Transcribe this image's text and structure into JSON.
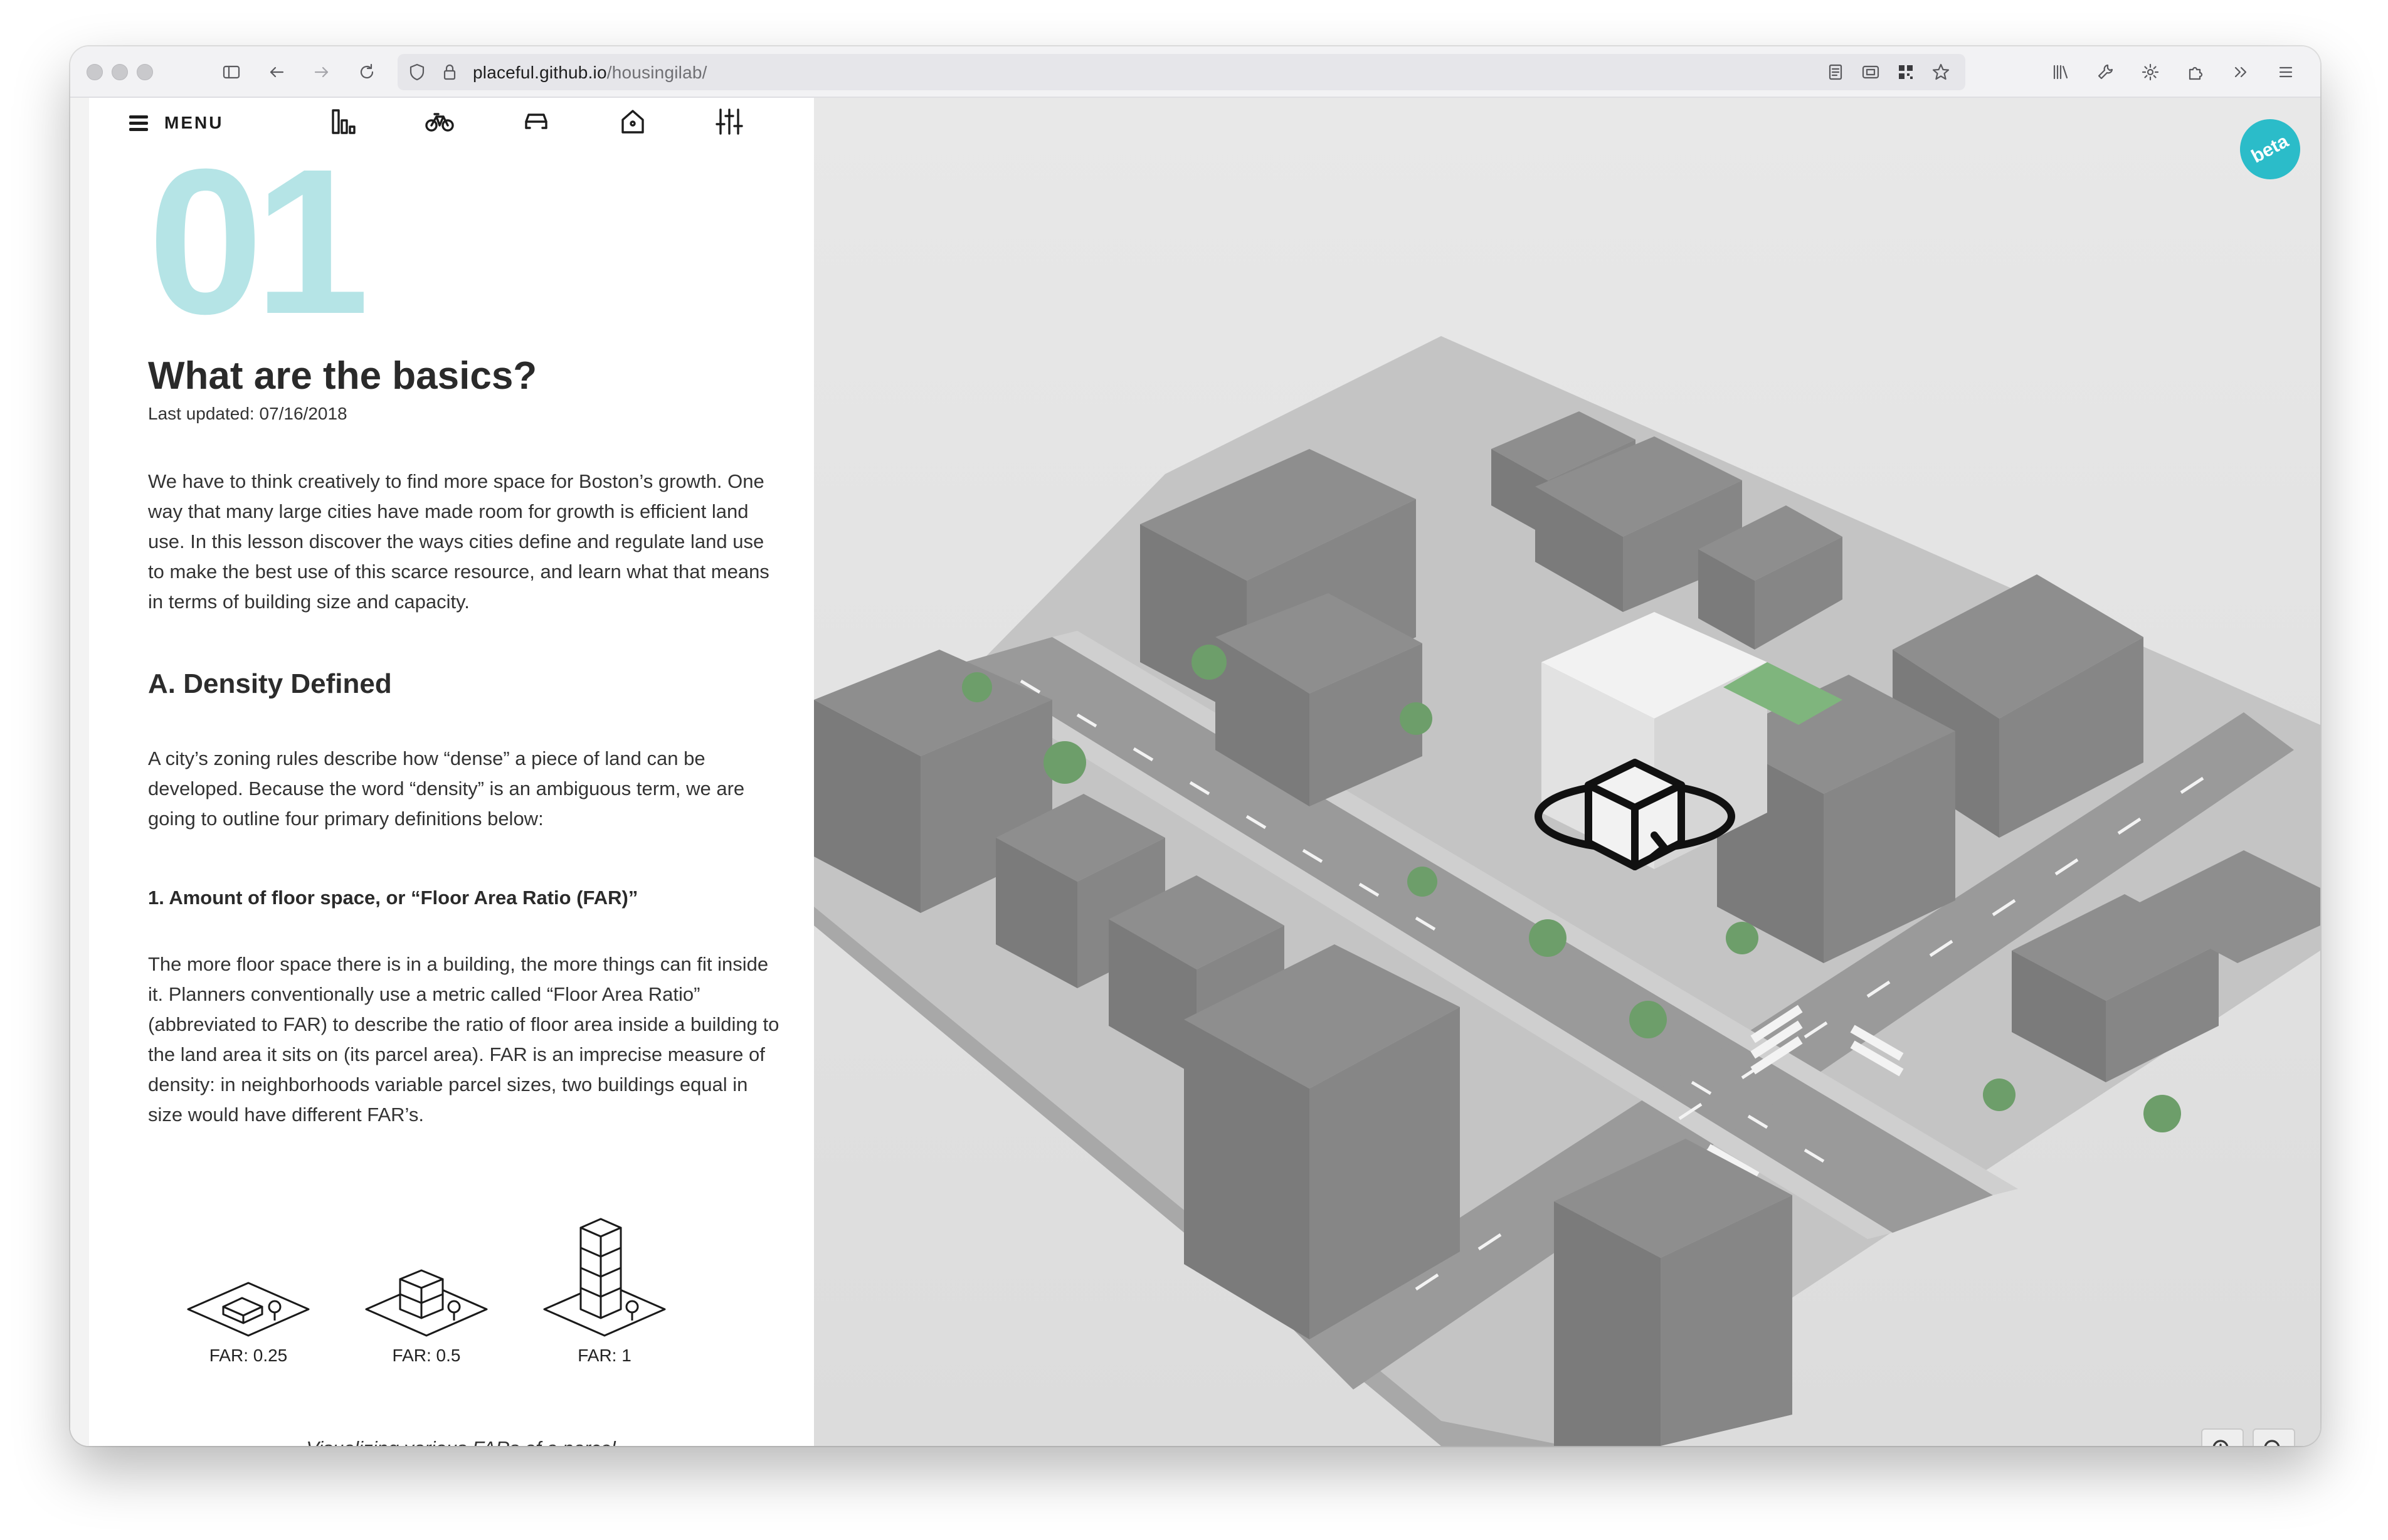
{
  "browser": {
    "url_host": "placeful.github.io",
    "url_path": "/housingilab/"
  },
  "nav": {
    "menu_label": "MENU"
  },
  "lesson": {
    "number": "01",
    "title": "What are the basics?",
    "updated": "Last updated: 07/16/2018",
    "intro": "We have to think creatively to find more space for Boston’s growth. One way that many large cities have made room for growth is efficient land use. In this lesson discover the ways cities define and regulate land use to make the best use of this scarce resource, and learn what that means in terms of building size and capacity.",
    "section_a_title": "A. Density Defined",
    "section_a_text": "A city’s zoning rules describe how “dense” a piece of land can be developed. Because the word “density” is an ambiguous term, we are going to outline four primary definitions below:",
    "sub1_title": "1. Amount of floor space, or “Floor Area Ratio (FAR)”",
    "sub1_text": "The more floor space there is in a building, the more things can fit inside it. Planners conventionally use a metric called “Floor Area Ratio” (abbreviated to FAR) to describe the ratio of floor area inside a building to the land area it sits on (its parcel area). FAR is an imprecise measure of density: in neighborhoods variable parcel sizes, two buildings equal in size would have different FAR’s.",
    "far_items": [
      {
        "label": "FAR: 0.25"
      },
      {
        "label": "FAR: 0.5"
      },
      {
        "label": "FAR: 1"
      }
    ],
    "caption": "Visualizing various FARs of a parcel"
  },
  "map": {
    "badge": "beta",
    "colors": {
      "building": "#8c8c8c",
      "road": "#9e9e9e",
      "ground": "#e3e3e3",
      "highlight": "#f2f2f2",
      "badge": "#2bbcc9"
    }
  }
}
